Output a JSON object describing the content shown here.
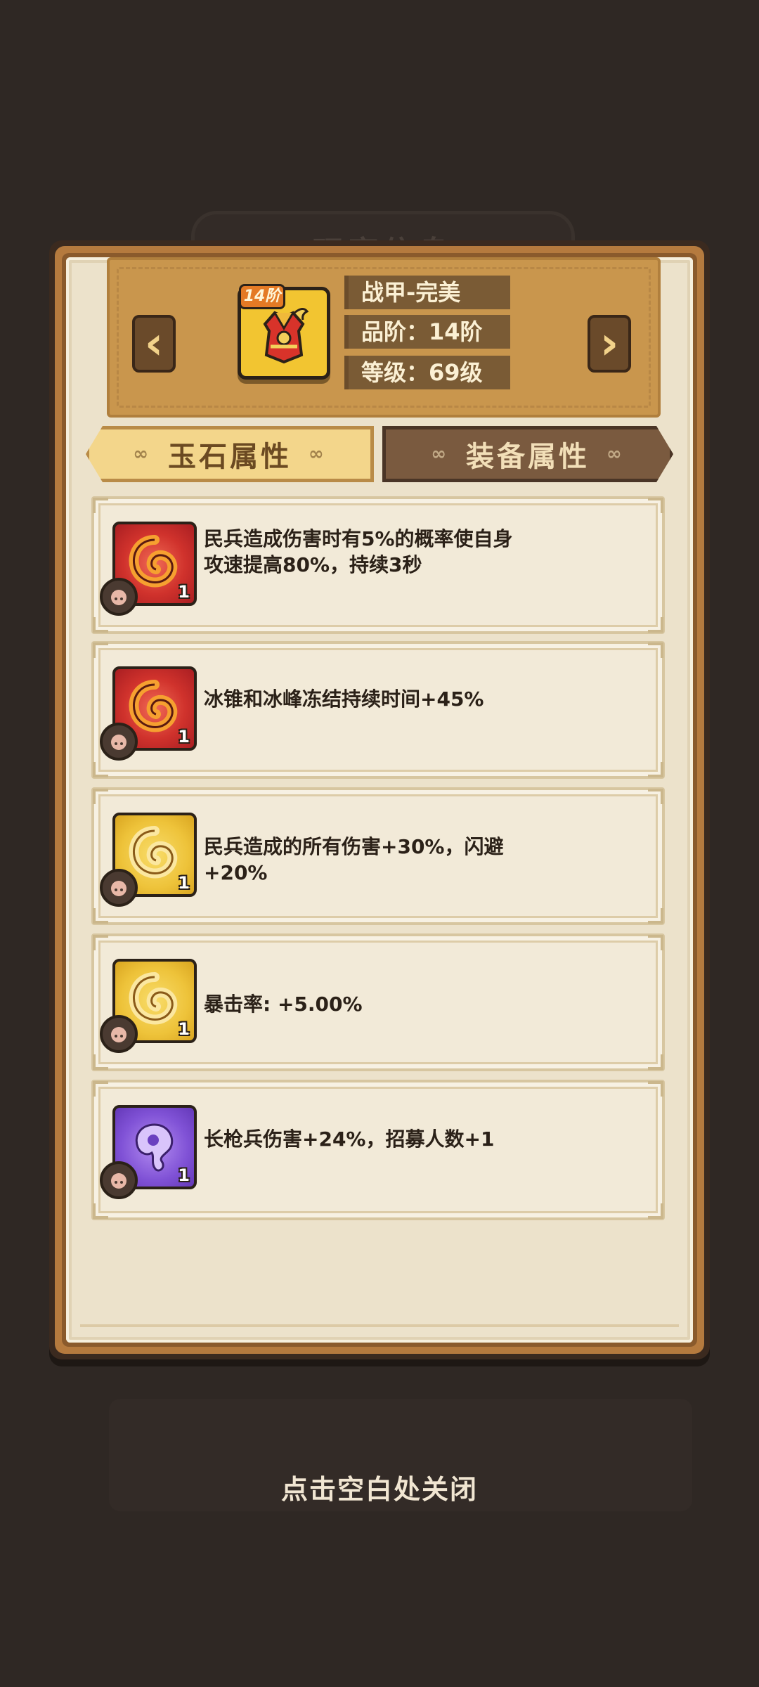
{
  "background": {
    "ghost_tab_text": "玩家信息"
  },
  "header": {
    "item_name": "战甲-完美",
    "quality": "品阶：14阶",
    "level": "等级：69级",
    "tier_badge": "14阶",
    "item_icon": "armor-icon",
    "prev_icon": "chevron-left-icon",
    "next_icon": "chevron-right-icon"
  },
  "tabs": {
    "jade": "玉石属性",
    "equipment": "装备属性"
  },
  "attributes": [
    {
      "gem_color": "red",
      "count": "1",
      "text": "民兵造成伤害时有5%的概率使自身攻速提高80%，持续3秒"
    },
    {
      "gem_color": "red",
      "count": "1",
      "text": "冰锥和冰峰冻结持续时间+45%"
    },
    {
      "gem_color": "gold",
      "count": "1",
      "text": "民兵造成的所有伤害+30%，闪避+20%"
    },
    {
      "gem_color": "gold",
      "count": "1",
      "text": "暴击率: +5.00%"
    },
    {
      "gem_color": "purple",
      "count": "1",
      "text": "长枪兵伤害+24%，招募人数+1"
    }
  ],
  "footer": {
    "close_hint": "点击空白处关闭"
  },
  "colors": {
    "background": "#2f2824",
    "parchment": "#ece2cb",
    "active_tab": "#f3d68b",
    "inactive_tab": "#7a5a3f"
  }
}
